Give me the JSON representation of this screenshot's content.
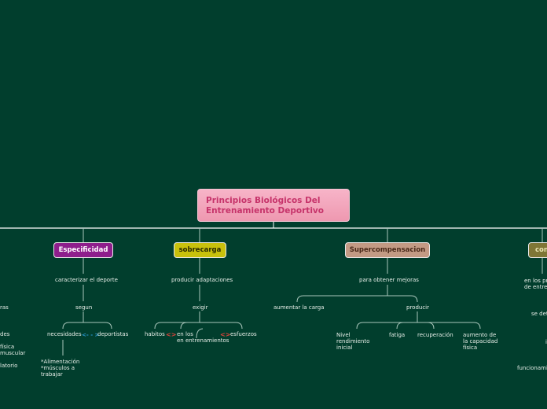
{
  "root": {
    "line1": "Principios Biológicos Del",
    "line2": "Entrenamiento Deportivo"
  },
  "branches": {
    "especificidad": {
      "title": "Especificidad",
      "color": "#8e1e8c",
      "caracterizar": "caracterizar el deporte",
      "segun": "segun",
      "necesidades": "necesidades",
      "deportistas": "deportistas",
      "needs": [
        "*Alimentación",
        "*músculos a",
        "trabajar"
      ]
    },
    "sobrecarga": {
      "title": "sobrecarga",
      "color": "#c9c10c",
      "producir": "producir adaptaciones",
      "exigir": "exigir",
      "habitos": "habitos",
      "en_los": [
        "en",
        "en",
        "los"
      ],
      "entrenamientos": "entrenamientos",
      "esfuerzos": "esfuerzos"
    },
    "supercompensacion": {
      "title": "Supercompensacion",
      "color": "#c39a84",
      "para_obtener": "para obtener mejoras",
      "aumentar": "aumentar la carga",
      "producir": "producir",
      "nivel": [
        "Nivel",
        "rendimiento",
        "inicial"
      ],
      "fatiga": "fatiga",
      "recuperacion": "recuperación",
      "aumento": [
        "aumento de",
        "la capacidad",
        "física"
      ]
    },
    "continuidad": {
      "title": "con",
      "color": "#7f7636",
      "en_los": [
        "en los pr",
        "de entre"
      ],
      "se_det": "se det",
      "funcionamiento": "funcionamie",
      "cut_letter": "i"
    }
  },
  "left_cut": {
    "items": [
      "ras",
      "des",
      "física",
      "muscular",
      "latorio"
    ]
  },
  "relation_symbols": {
    "double_arrow": "<>",
    "dashed_arrow": "<- - >"
  },
  "colors": {
    "background": "#013e2d",
    "link": "#8fb3a6"
  }
}
